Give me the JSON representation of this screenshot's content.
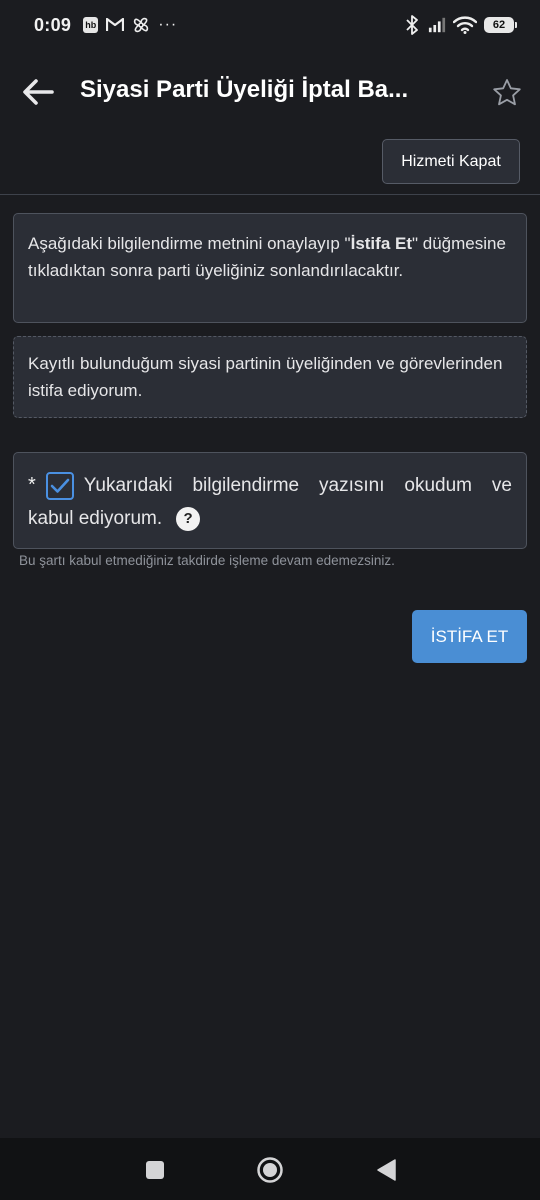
{
  "status_bar": {
    "time": "0:09",
    "hb_badge": "hb",
    "more": "···",
    "battery": "62"
  },
  "app_bar": {
    "title": "Siyasi Parti Üyeliği İptal Ba..."
  },
  "actions": {
    "close_service_label": "Hizmeti Kapat",
    "resign_label": "İSTİFA ET"
  },
  "info": {
    "part1": "Aşağıdaki bilgilendirme metnini onaylayıp \"",
    "bold": "İstifa Et",
    "part2": "\" düğmesine tıkladıktan sonra parti üyeliğiniz sonlandırılacaktır."
  },
  "statement": {
    "text": "Kayıtlı bulunduğum siyasi partinin üyeliğinden ve görevlerinden istifa ediyorum."
  },
  "consent": {
    "asterisk": "*",
    "w1": "Yukarıdaki",
    "w2": "bilgilendirme",
    "w3": "yazısını",
    "w4": "okudum",
    "w5": "ve",
    "line2": "kabul ediyorum.",
    "help": "?",
    "checked": true,
    "hint": "Bu şartı kabul etmediğiniz takdirde işleme devam edemezsiniz."
  },
  "colors": {
    "background": "#1b1c20",
    "card": "#2b2e36",
    "accent": "#4a8ed4",
    "checkbox": "#4a90e2"
  }
}
